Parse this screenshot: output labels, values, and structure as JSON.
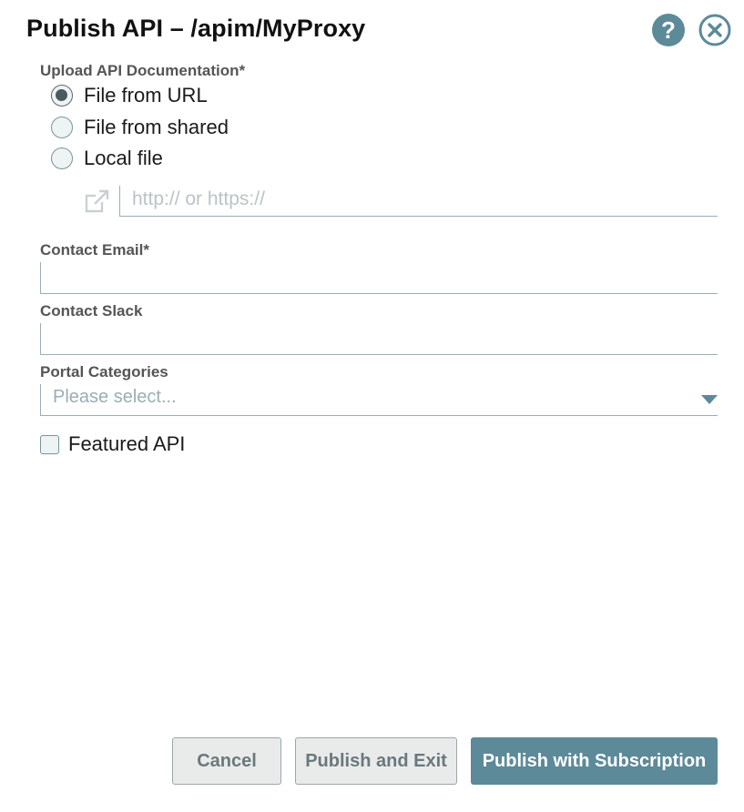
{
  "dialog": {
    "title": "Publish API – /apim/MyProxy",
    "help_icon": "question-mark-icon",
    "help_glyph": "?",
    "close_icon": "close-circle-icon"
  },
  "upload": {
    "label": "Upload API Documentation*",
    "options": [
      {
        "label": "File from URL",
        "selected": true
      },
      {
        "label": "File from shared",
        "selected": false
      },
      {
        "label": "Local file",
        "selected": false
      }
    ],
    "url_icon": "external-link-icon",
    "url_placeholder": "http:// or https://"
  },
  "contact_email": {
    "label": "Contact Email*",
    "value": ""
  },
  "contact_slack": {
    "label": "Contact Slack",
    "value": ""
  },
  "portal_categories": {
    "label": "Portal Categories",
    "placeholder": "Please select..."
  },
  "featured": {
    "label": "Featured API",
    "checked": false
  },
  "buttons": {
    "cancel": "Cancel",
    "publish_exit": "Publish and Exit",
    "publish_subscription": "Publish with Subscription"
  },
  "colors": {
    "accent": "#5c8a99",
    "secondary_button_bg": "#e9ebeb",
    "label_gray": "#555555"
  }
}
